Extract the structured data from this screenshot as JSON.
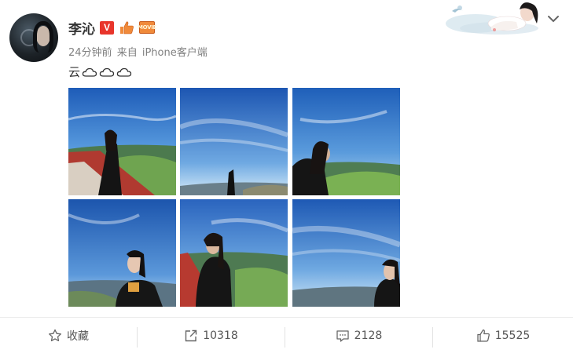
{
  "post": {
    "author": "李沁",
    "verified_badge": "V",
    "movie_badge": "MOVIE",
    "meta_time": "24分钟前",
    "meta_source_prefix": "来自",
    "meta_source": "iPhone客户端",
    "text": "云"
  },
  "icons": {
    "cloud_count": 3,
    "verified": "verified-v-icon",
    "thumb": "thumbs-up-badge-icon",
    "movie": "movie-badge-icon",
    "menu": "chevron-down-icon"
  },
  "images": [
    {
      "label": "photo-1"
    },
    {
      "label": "photo-2"
    },
    {
      "label": "photo-3"
    },
    {
      "label": "photo-4"
    },
    {
      "label": "photo-5"
    },
    {
      "label": "photo-6"
    }
  ],
  "toolbar": {
    "favorite_label": "收藏",
    "repost_count": "10318",
    "comment_count": "2128",
    "like_count": "15525"
  },
  "colors": {
    "sky": "#2f6fc4",
    "verified_red": "#e8352b",
    "movie_orange": "#f08a3a"
  }
}
